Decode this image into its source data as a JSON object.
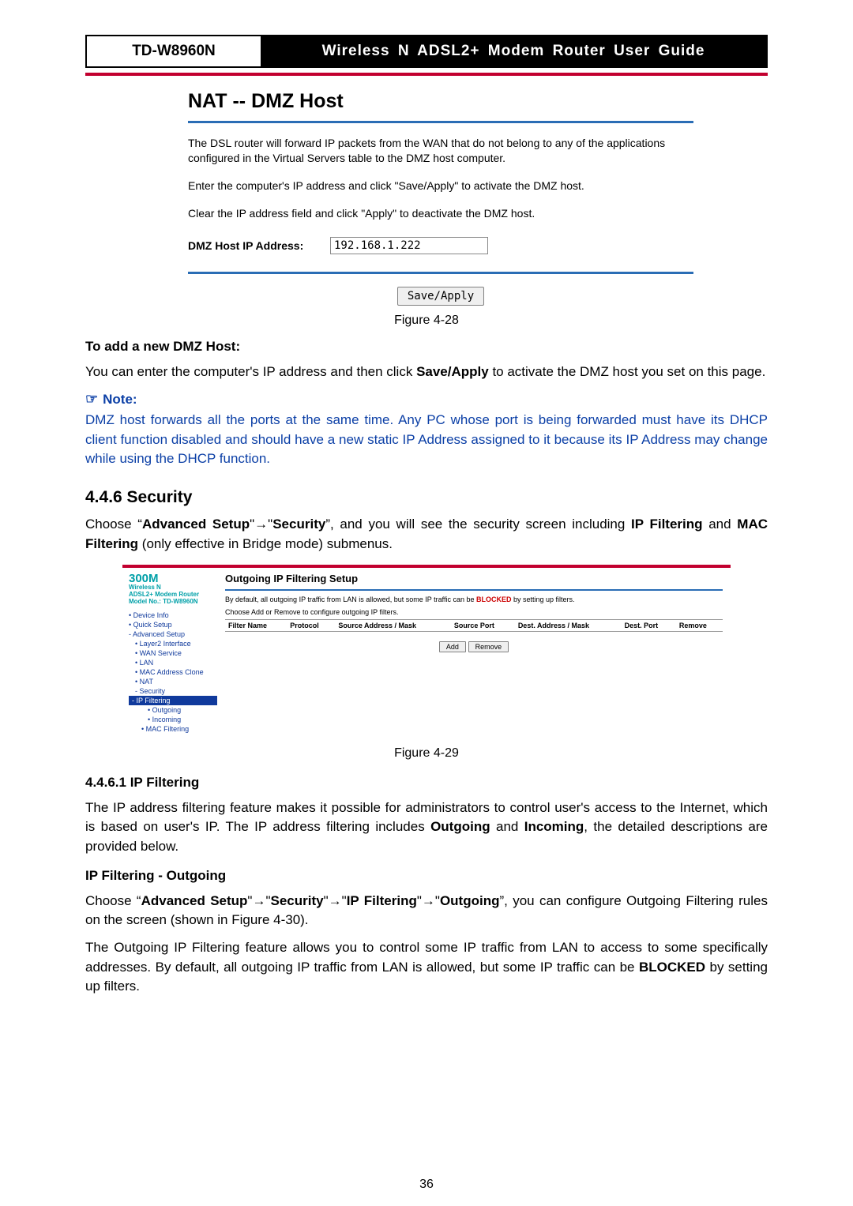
{
  "header": {
    "model": "TD-W8960N",
    "title": "Wireless N ADSL2+ Modem Router User Guide"
  },
  "fig28": {
    "title": "NAT -- DMZ Host",
    "p1": "The DSL router will forward IP packets from the WAN that do not belong to any of the applications configured in the Virtual Servers table to the DMZ host computer.",
    "p2": "Enter the computer's IP address and click \"Save/Apply\" to activate the DMZ host.",
    "p3": "Clear the IP address field and click \"Apply\" to deactivate the DMZ host.",
    "ip_label": "DMZ Host IP Address:",
    "ip_value": "192.168.1.222",
    "save_btn": "Save/Apply",
    "caption": "Figure 4-28"
  },
  "text": {
    "addhead": "To add a new DMZ Host:",
    "addpara_a": "You can enter the computer's IP address and then click ",
    "addpara_bold": "Save/Apply",
    "addpara_b": " to activate the DMZ host you set on this page.",
    "note_label": "Note:",
    "note_body": "DMZ host forwards all the ports at the same time. Any PC whose port is being forwarded must have its DHCP client function disabled and should have a new static IP Address assigned to it because its IP Address may change while using the DHCP function.",
    "sec_head": "4.4.6  Security",
    "sec_para_a": "Choose “",
    "sec_para_b": "Advanced Setup",
    "sec_para_c": "Security",
    "sec_para_d": "”, and you will see the security screen including ",
    "sec_para_e": "IP Filtering",
    "sec_para_f": " and ",
    "sec_para_g": "MAC Filtering",
    "sec_para_h": " (only effective in Bridge mode) submenus.",
    "fig29_caption": "Figure 4-29",
    "ipf_head": "4.4.6.1   IP Filtering",
    "ipf_para_a": "The IP address filtering feature makes it possible for administrators to control user's access to the Internet, which is based on user's IP. The IP address filtering includes ",
    "ipf_para_b": "Outgoing",
    "ipf_para_c": " and ",
    "ipf_para_d": "Incoming",
    "ipf_para_e": ", the detailed descriptions are provided below.",
    "ipfo_head": "IP Filtering - Outgoing",
    "ipfo_a": "Choose “",
    "ipfo_b": "Advanced Setup",
    "ipfo_c": "Security",
    "ipfo_d": "IP Filtering",
    "ipfo_e": "Outgoing",
    "ipfo_f": "”, you can configure Outgoing Filtering rules on the screen (shown in Figure 4-30).",
    "ipfo2_a": "The Outgoing IP Filtering feature allows you to control some IP traffic from LAN to access to some specifically addresses. By default, all outgoing IP traffic from LAN is allowed, but some IP traffic can be ",
    "ipfo2_b": "BLOCKED",
    "ipfo2_c": " by setting up filters.",
    "pagenum": "36"
  },
  "fig29": {
    "brand_big": "300M",
    "brand_l1": "Wireless N",
    "brand_l2": "ADSL2+ Modem Router",
    "brand_l3": "Model No.: TD-W8960N",
    "side": [
      {
        "label": "• Device Info",
        "cls": ""
      },
      {
        "label": "• Quick Setup",
        "cls": ""
      },
      {
        "label": "- Advanced Setup",
        "cls": ""
      },
      {
        "label": "• Layer2 Interface",
        "cls": "indent1"
      },
      {
        "label": "• WAN Service",
        "cls": "indent1"
      },
      {
        "label": "• LAN",
        "cls": "indent1"
      },
      {
        "label": "• MAC Address Clone",
        "cls": "indent1"
      },
      {
        "label": "• NAT",
        "cls": "indent1"
      },
      {
        "label": "- Security",
        "cls": "indent1"
      },
      {
        "label": "- IP Filtering",
        "cls": "indent2 sel"
      },
      {
        "label": "• Outgoing",
        "cls": "indent3"
      },
      {
        "label": "• Incoming",
        "cls": "indent3"
      },
      {
        "label": "• MAC Filtering",
        "cls": "indent2"
      }
    ],
    "main_title": "Outgoing IP Filtering Setup",
    "desc_a": "By default, all outgoing IP traffic from LAN is allowed, but some IP traffic can be ",
    "desc_b": "BLOCKED",
    "desc_c": " by setting up filters.",
    "desc2": "Choose Add or Remove to configure outgoing IP filters.",
    "cols": [
      "Filter Name",
      "Protocol",
      "Source Address / Mask",
      "Source Port",
      "Dest. Address / Mask",
      "Dest. Port",
      "Remove"
    ],
    "btn_add": "Add",
    "btn_remove": "Remove"
  }
}
